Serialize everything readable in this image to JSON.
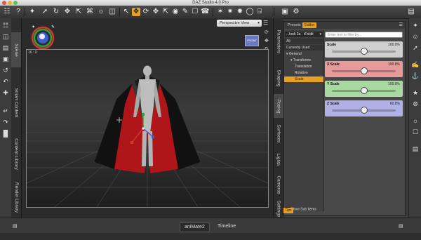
{
  "window": {
    "title": "DAZ Studio 4.0 Pro"
  },
  "toolbar": {
    "icons": [
      "new-file",
      "help",
      "pointer",
      "universal-tool",
      "rotate",
      "translate",
      "scale",
      "node-select",
      "camera-orbit",
      "camera-pan",
      "light",
      "geometry",
      "joint-editor",
      "surface-select",
      "region",
      "render",
      "render-settings"
    ]
  },
  "left_tabs": [
    "Scene",
    "Smart Content",
    "Content Library",
    "Render Library"
  ],
  "viewport": {
    "camera_button": "Perspective View",
    "label": "16 : 9"
  },
  "panel_tabs": [
    "Parameters",
    "Shaping",
    "Posing",
    "Surfaces",
    "Lights",
    "Cameras",
    "Settings"
  ],
  "panel": {
    "tabs": [
      "Presets",
      "Editor"
    ],
    "active_tab": "Editor",
    "preset_dropdown": "...look 2a - rFoldit",
    "tree": [
      {
        "label": "All",
        "level": 0,
        "state": "hl"
      },
      {
        "label": "Currently Used",
        "level": 0,
        "state": "hl"
      },
      {
        "label": "▾ General",
        "level": 0,
        "state": ""
      },
      {
        "label": "▾ Transforms",
        "level": 1,
        "state": ""
      },
      {
        "label": "Translation",
        "level": 2,
        "state": ""
      },
      {
        "label": "Rotation",
        "level": 2,
        "state": ""
      },
      {
        "label": "Scale",
        "level": 2,
        "state": "sel"
      }
    ],
    "filter_placeholder": "Enter text to filter by...",
    "params": [
      {
        "label": "Scale",
        "value": "100.0%",
        "color": "#cfcfcf",
        "level": 0.5
      },
      {
        "label": "X Scale",
        "value": "100.0%",
        "color": "#e79a9a",
        "level": 0.5
      },
      {
        "label": "Y Scale",
        "value": "100.0%",
        "color": "#a8d9a0",
        "level": 0.5
      },
      {
        "label": "Z Scale",
        "value": "60.0%",
        "color": "#aeb0e6",
        "level": 0.5
      }
    ],
    "show_sub_items": "Show Sub Items"
  },
  "tips_label": "Tips",
  "bottom_tabs": [
    {
      "label": "aniMate2",
      "active": true
    },
    {
      "label": "Timeline",
      "active": false
    }
  ]
}
